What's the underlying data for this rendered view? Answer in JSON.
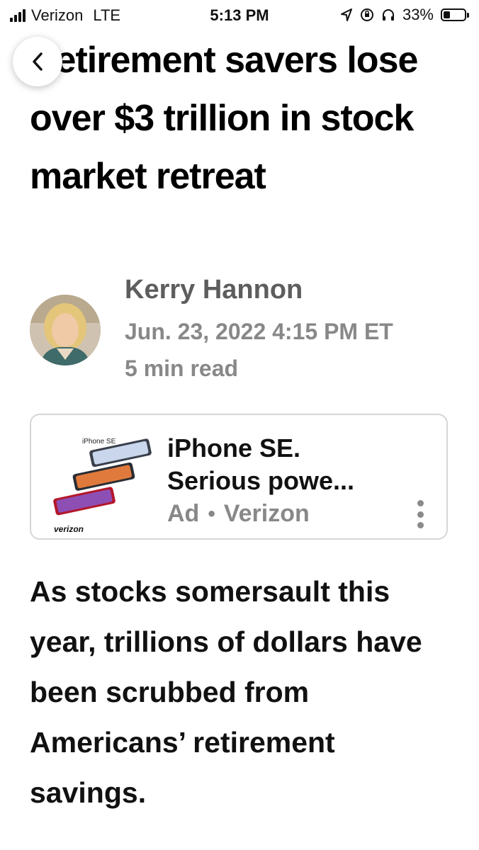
{
  "status_bar": {
    "carrier": "Verizon",
    "network": "LTE",
    "time": "5:13 PM",
    "battery_percent": "33%",
    "battery_level": 0.33,
    "icons": [
      "signal-icon",
      "location-arrow-icon",
      "rotation-lock-icon",
      "headphones-icon",
      "battery-icon"
    ]
  },
  "nav": {
    "back_icon": "chevron-left-icon"
  },
  "article": {
    "headline": "Retirement savers lose over $3 trillion in stock market retreat",
    "author": "Kerry Hannon",
    "date": "Jun. 23, 2022 4:15 PM ET",
    "read_time": "5 min read",
    "body": "As stocks somersault this year, trillions of dollars have been scrubbed from Americans’ retirement savings."
  },
  "ad": {
    "image_label_top": "iPhone SE",
    "image_label_bottom": "verizon",
    "title": "iPhone SE. Serious powe...",
    "label": "Ad",
    "separator": "•",
    "sponsor": "Verizon",
    "menu_icon": "vertical-ellipsis-icon"
  }
}
